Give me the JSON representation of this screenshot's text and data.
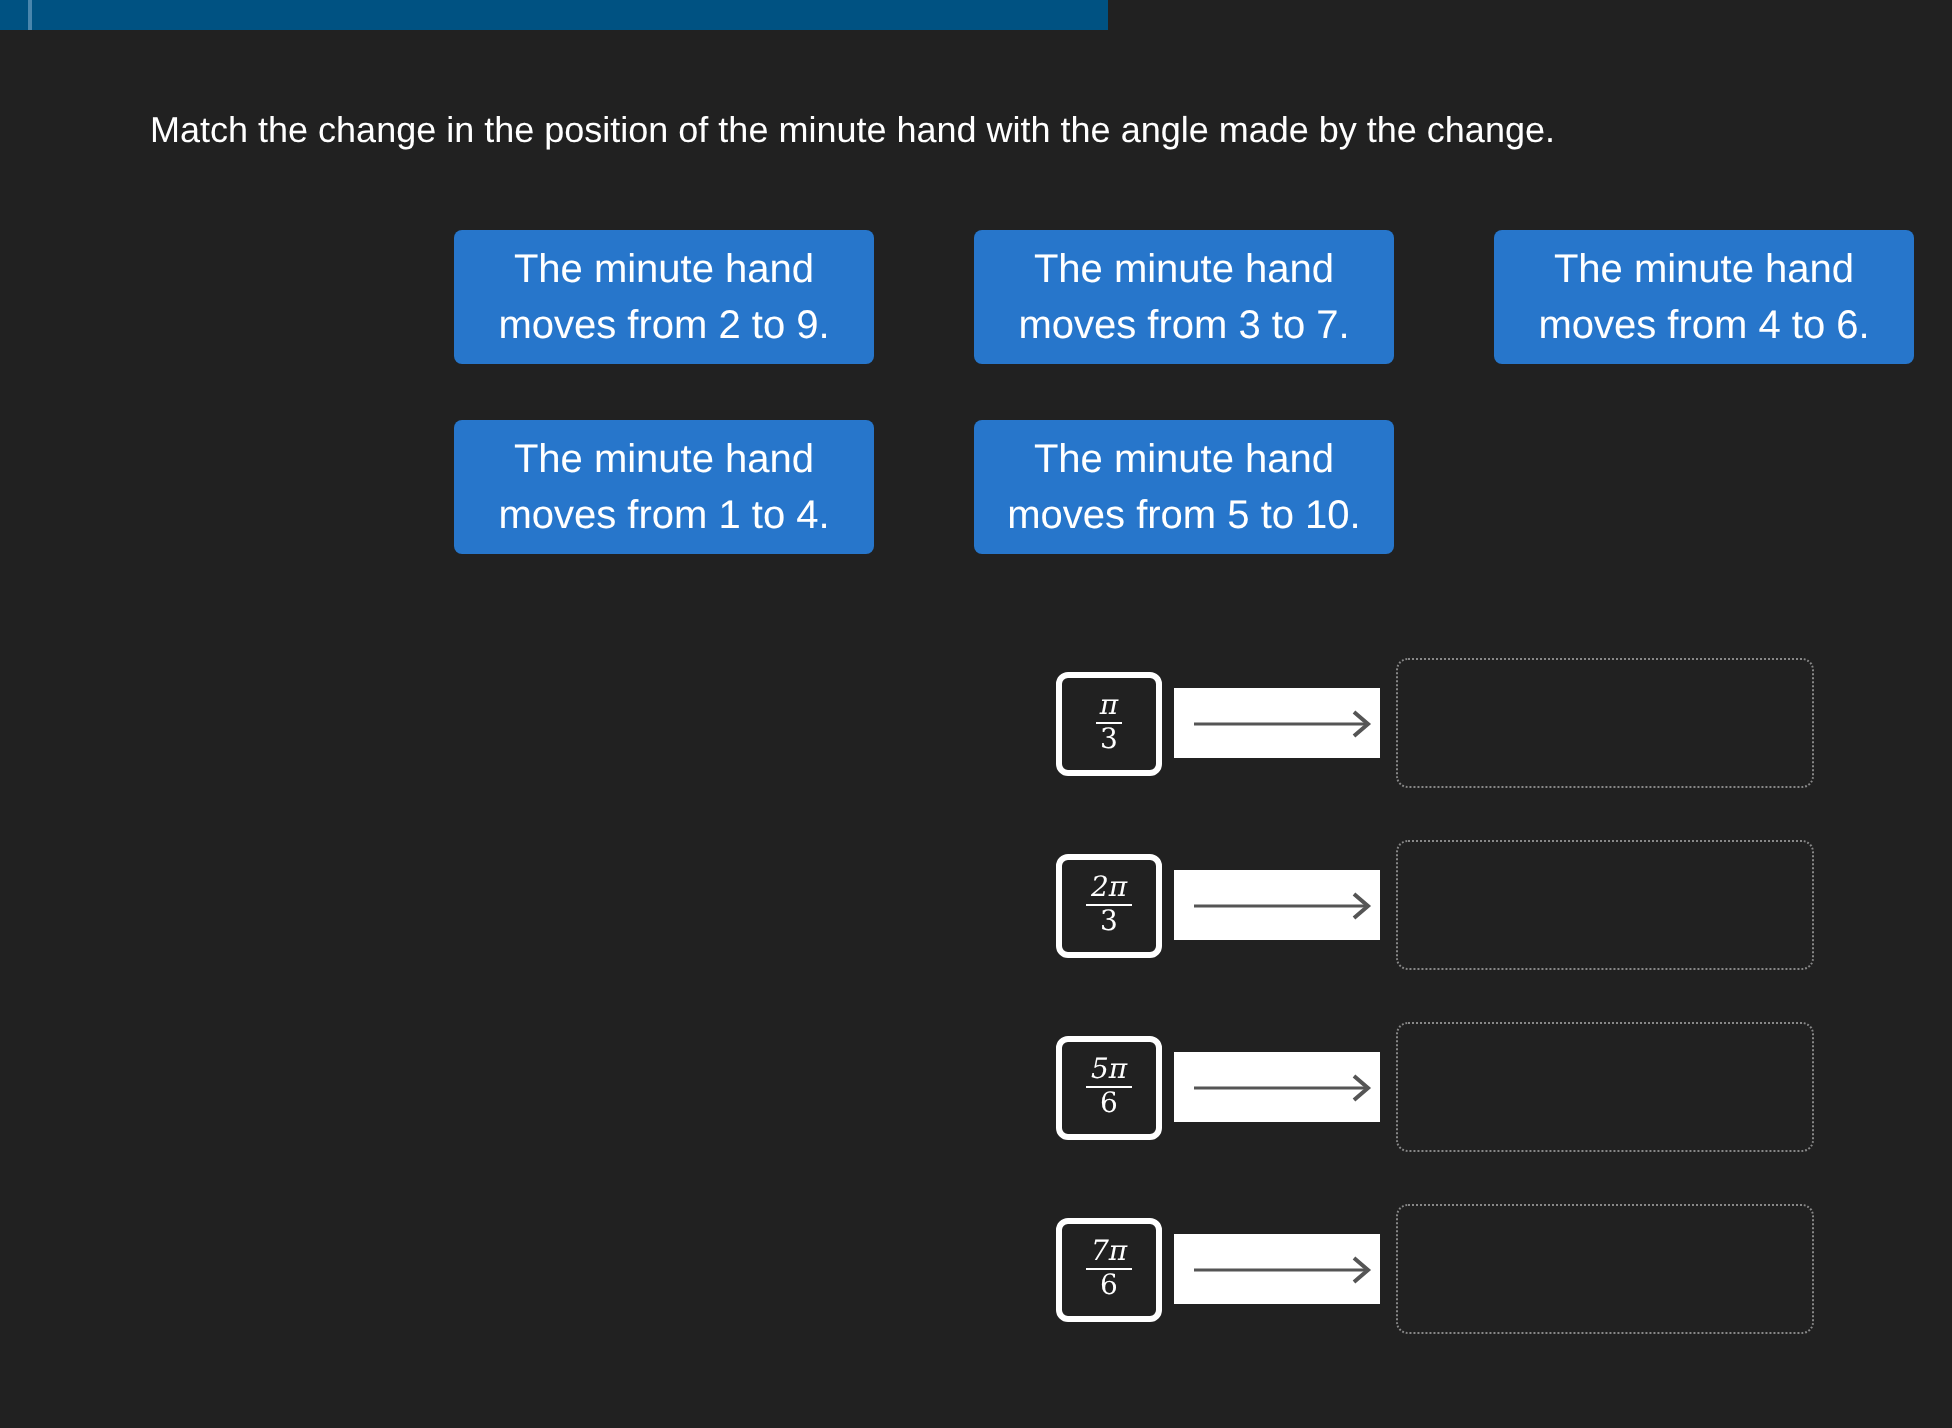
{
  "progress": {
    "level": 0.568
  },
  "question": "Match the change in the position of the minute hand with the angle made by the change.",
  "cards": [
    {
      "text": "The minute hand moves from 2 to 9."
    },
    {
      "text": "The minute hand moves from 3 to 7."
    },
    {
      "text": "The minute hand moves from 4 to 6."
    },
    {
      "text": "The minute hand moves from 1 to 4."
    },
    {
      "text": "The minute hand moves from 5 to 10."
    }
  ],
  "targets": [
    {
      "numerator": "π",
      "denominator": "3"
    },
    {
      "numerator": "2π",
      "denominator": "3"
    },
    {
      "numerator": "5π",
      "denominator": "6"
    },
    {
      "numerator": "7π",
      "denominator": "6"
    }
  ]
}
